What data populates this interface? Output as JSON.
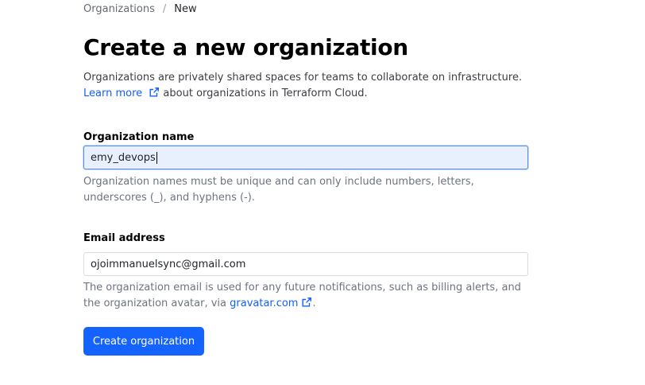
{
  "breadcrumb": {
    "parent": "Organizations",
    "separator": "/",
    "current": "New"
  },
  "page": {
    "title": "Create a new organization",
    "intro_text": "Organizations are privately shared spaces for teams to collaborate on infrastructure.",
    "learn_more_label": "Learn more",
    "learn_more_suffix": " about organizations in Terraform Cloud."
  },
  "form": {
    "org_name": {
      "label": "Organization name",
      "value": "emy_devops",
      "help": "Organization names must be unique and can only include numbers, letters, underscores (_), and hyphens (-)."
    },
    "email": {
      "label": "Email address",
      "value": "ojoimmanuelsync@gmail.com",
      "help_prefix": "The organization email is used for any future notifications, such as billing alerts, and the organization avatar, via ",
      "help_link": "gravatar.com",
      "help_suffix": "."
    },
    "submit_label": "Create organization"
  },
  "colors": {
    "accent": "#1563ff",
    "link": "#1060ff",
    "focused_input_bg": "#e8f0fe"
  },
  "icons": {
    "external": "external-link-icon"
  }
}
